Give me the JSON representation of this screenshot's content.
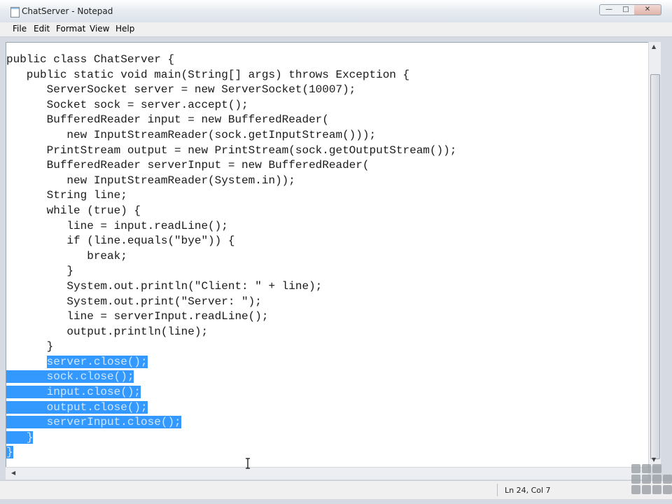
{
  "window": {
    "title": "ChatServer - Notepad",
    "buttons": {
      "minimize": "—",
      "maximize": "□",
      "close": "✕"
    }
  },
  "menu": [
    "File",
    "Edit",
    "Format",
    "View",
    "Help"
  ],
  "editor": {
    "lines": [
      {
        "text": "public class ChatServer {",
        "selected": ""
      },
      {
        "text": "   public static void main(String[] args) throws Exception {",
        "selected": ""
      },
      {
        "text": "      ServerSocket server = new ServerSocket(10007);",
        "selected": ""
      },
      {
        "text": "      Socket sock = server.accept();",
        "selected": ""
      },
      {
        "text": "      BufferedReader input = new BufferedReader(",
        "selected": ""
      },
      {
        "text": "         new InputStreamReader(sock.getInputStream()));",
        "selected": ""
      },
      {
        "text": "      PrintStream output = new PrintStream(sock.getOutputStream());",
        "selected": ""
      },
      {
        "text": "      BufferedReader serverInput = new BufferedReader(",
        "selected": ""
      },
      {
        "text": "         new InputStreamReader(System.in));",
        "selected": ""
      },
      {
        "text": "      String line;",
        "selected": ""
      },
      {
        "text": "      while (true) {",
        "selected": ""
      },
      {
        "text": "         line = input.readLine();",
        "selected": ""
      },
      {
        "text": "         if (line.equals(\"bye\")) {",
        "selected": ""
      },
      {
        "text": "            break;",
        "selected": ""
      },
      {
        "text": "         }",
        "selected": ""
      },
      {
        "text": "         System.out.println(\"Client: \" + line);",
        "selected": ""
      },
      {
        "text": "         System.out.print(\"Server: \");",
        "selected": ""
      },
      {
        "text": "         line = serverInput.readLine();",
        "selected": ""
      },
      {
        "text": "         output.println(line);",
        "selected": ""
      },
      {
        "text": "      }",
        "selected": ""
      },
      {
        "text": "      ",
        "selected": "server.close();"
      },
      {
        "text": "",
        "selected": "      sock.close();"
      },
      {
        "text": "",
        "selected": "      input.close();"
      },
      {
        "text": "",
        "selected": "      output.close();"
      },
      {
        "text": "",
        "selected": "      serverInput.close();"
      },
      {
        "text": "",
        "selected": "   }"
      },
      {
        "text": "",
        "selected": "}"
      }
    ]
  },
  "status": {
    "position": "Ln 24, Col 7"
  },
  "colors": {
    "selection": "#3399ff",
    "editor_bg": "#ffffff"
  },
  "icons": [
    "notepad-app-icon",
    "ibeam-cursor-icon",
    "watermark-logo"
  ]
}
